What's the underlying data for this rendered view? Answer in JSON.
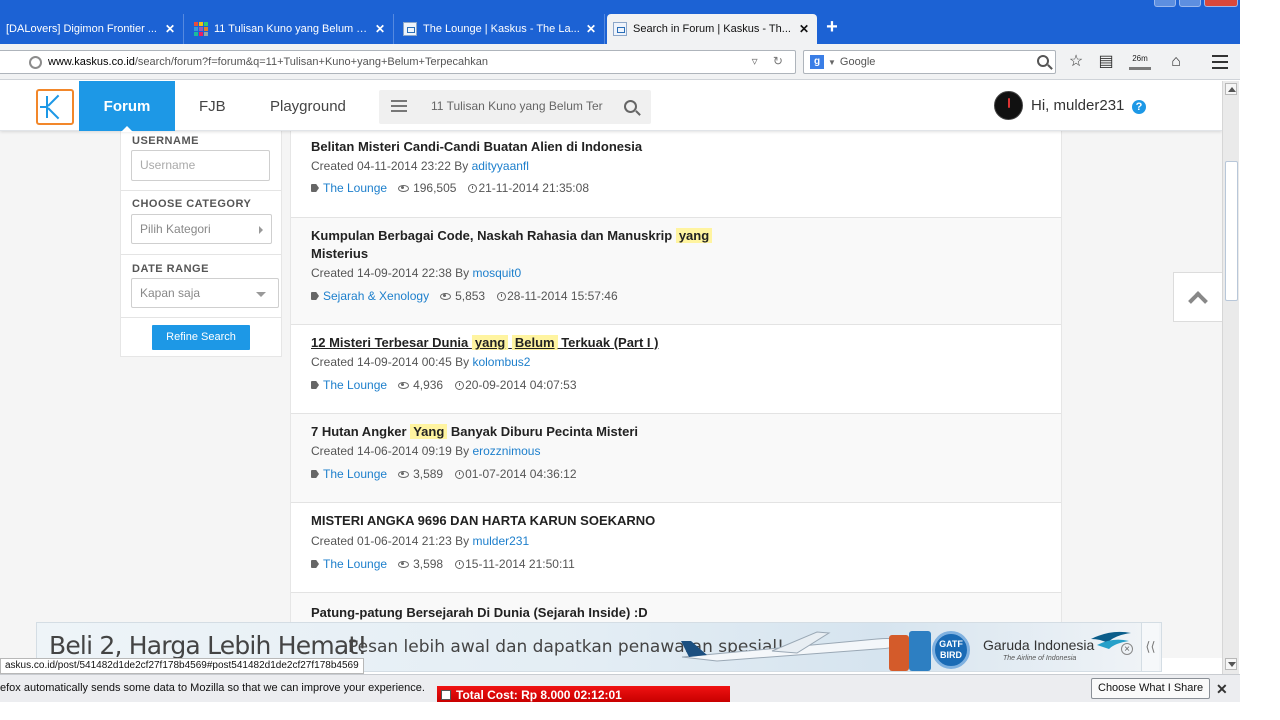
{
  "browser": {
    "tabs": [
      {
        "label": "[DALovers] Digimon Frontier ...",
        "close": "✕",
        "active": false
      },
      {
        "label": "11 Tulisan Kuno yang Belum T...",
        "close": "✕",
        "active": false
      },
      {
        "label": "The Lounge | Kaskus - The La...",
        "close": "✕",
        "active": false
      },
      {
        "label": "Search in Forum | Kaskus - Th...",
        "close": "✕",
        "active": true
      }
    ],
    "new_tab": "+",
    "url_domain": "www.kaskus.co.id",
    "url_path": "/search/forum?f=forum&q=11+Tulisan+Kuno+yang+Belum+Terpecahkan",
    "search_engine": "Google",
    "download_badge": "26m"
  },
  "site": {
    "nav": {
      "forum": "Forum",
      "fjb": "FJB",
      "playground": "Playground"
    },
    "search_value": "11 Tulisan Kuno yang Belum Ter",
    "greeting": "Hi, mulder231",
    "help": "?",
    "accent": "#1d98e6"
  },
  "sidebar": {
    "username_label": "USERNAME",
    "username_placeholder": "Username",
    "category_label": "CHOOSE CATEGORY",
    "category_value": "Pilih Kategori",
    "date_label": "DATE RANGE",
    "date_value": "Kapan saja",
    "refine_button": "Refine Search"
  },
  "results": [
    {
      "title_parts": [
        "Belitan Misteri Candi-Candi Buatan Alien di Indonesia"
      ],
      "created_prefix": "Created 04-11-2014 23:22 By ",
      "author": "adityyaanfl",
      "category": "The Lounge",
      "views": "196,505",
      "last_post": "21-11-2014 21:35:08"
    },
    {
      "title_parts": [
        "Kumpulan Berbagai Code, Naskah Rahasia dan Manuskrip ",
        "yang",
        " Misterius"
      ],
      "created_prefix": "Created 14-09-2014 22:38 By ",
      "author": "mosquit0",
      "category": "Sejarah & Xenology",
      "views": "5,853",
      "last_post": "28-11-2014 15:57:46"
    },
    {
      "title_parts": [
        "12 Misteri Terbesar Dunia ",
        "yang",
        " ",
        "Belum",
        " Terkuak (Part I )"
      ],
      "created_prefix": "Created 14-09-2014 00:45 By ",
      "author": "kolombus2",
      "category": "The Lounge",
      "views": "4,936",
      "last_post": "20-09-2014 04:07:53"
    },
    {
      "title_parts": [
        "7 Hutan Angker ",
        "Yang",
        " Banyak Diburu Pecinta Misteri"
      ],
      "created_prefix": "Created 14-06-2014 09:19 By ",
      "author": "erozznimous",
      "category": "The Lounge",
      "views": "3,589",
      "last_post": "01-07-2014 04:36:12"
    },
    {
      "title_parts": [
        "MISTERI ANGKA 9696 DAN HARTA KARUN SOEKARNO"
      ],
      "created_prefix": "Created 01-06-2014 21:23 By ",
      "author": "mulder231",
      "category": "The Lounge",
      "views": "3,598",
      "last_post": "15-11-2014 21:50:11"
    },
    {
      "title_parts": [
        "Patung-patung Bersejarah Di Dunia (Sejarah Inside) :D"
      ]
    }
  ],
  "ad": {
    "headline": "Beli 2, Harga Lebih Hemat!",
    "subline": "Pesan lebih awal dan dapatkan penawaran spesial!",
    "badge": "Garuda Indonesia",
    "tagline": "The Airline of Indonesia",
    "collapse": "⟨⟨"
  },
  "status_bar_url": "askus.co.id/post/541482d1de2cf27f178b4569#post541482d1de2cf27f178b4569",
  "notification": {
    "text": "efox automatically sends some data to Mozilla so that we can improve your experience.",
    "button": "Choose What I Share",
    "close": "✕"
  },
  "cost_overlay": "Total Cost: Rp 8.000    02:12:01"
}
